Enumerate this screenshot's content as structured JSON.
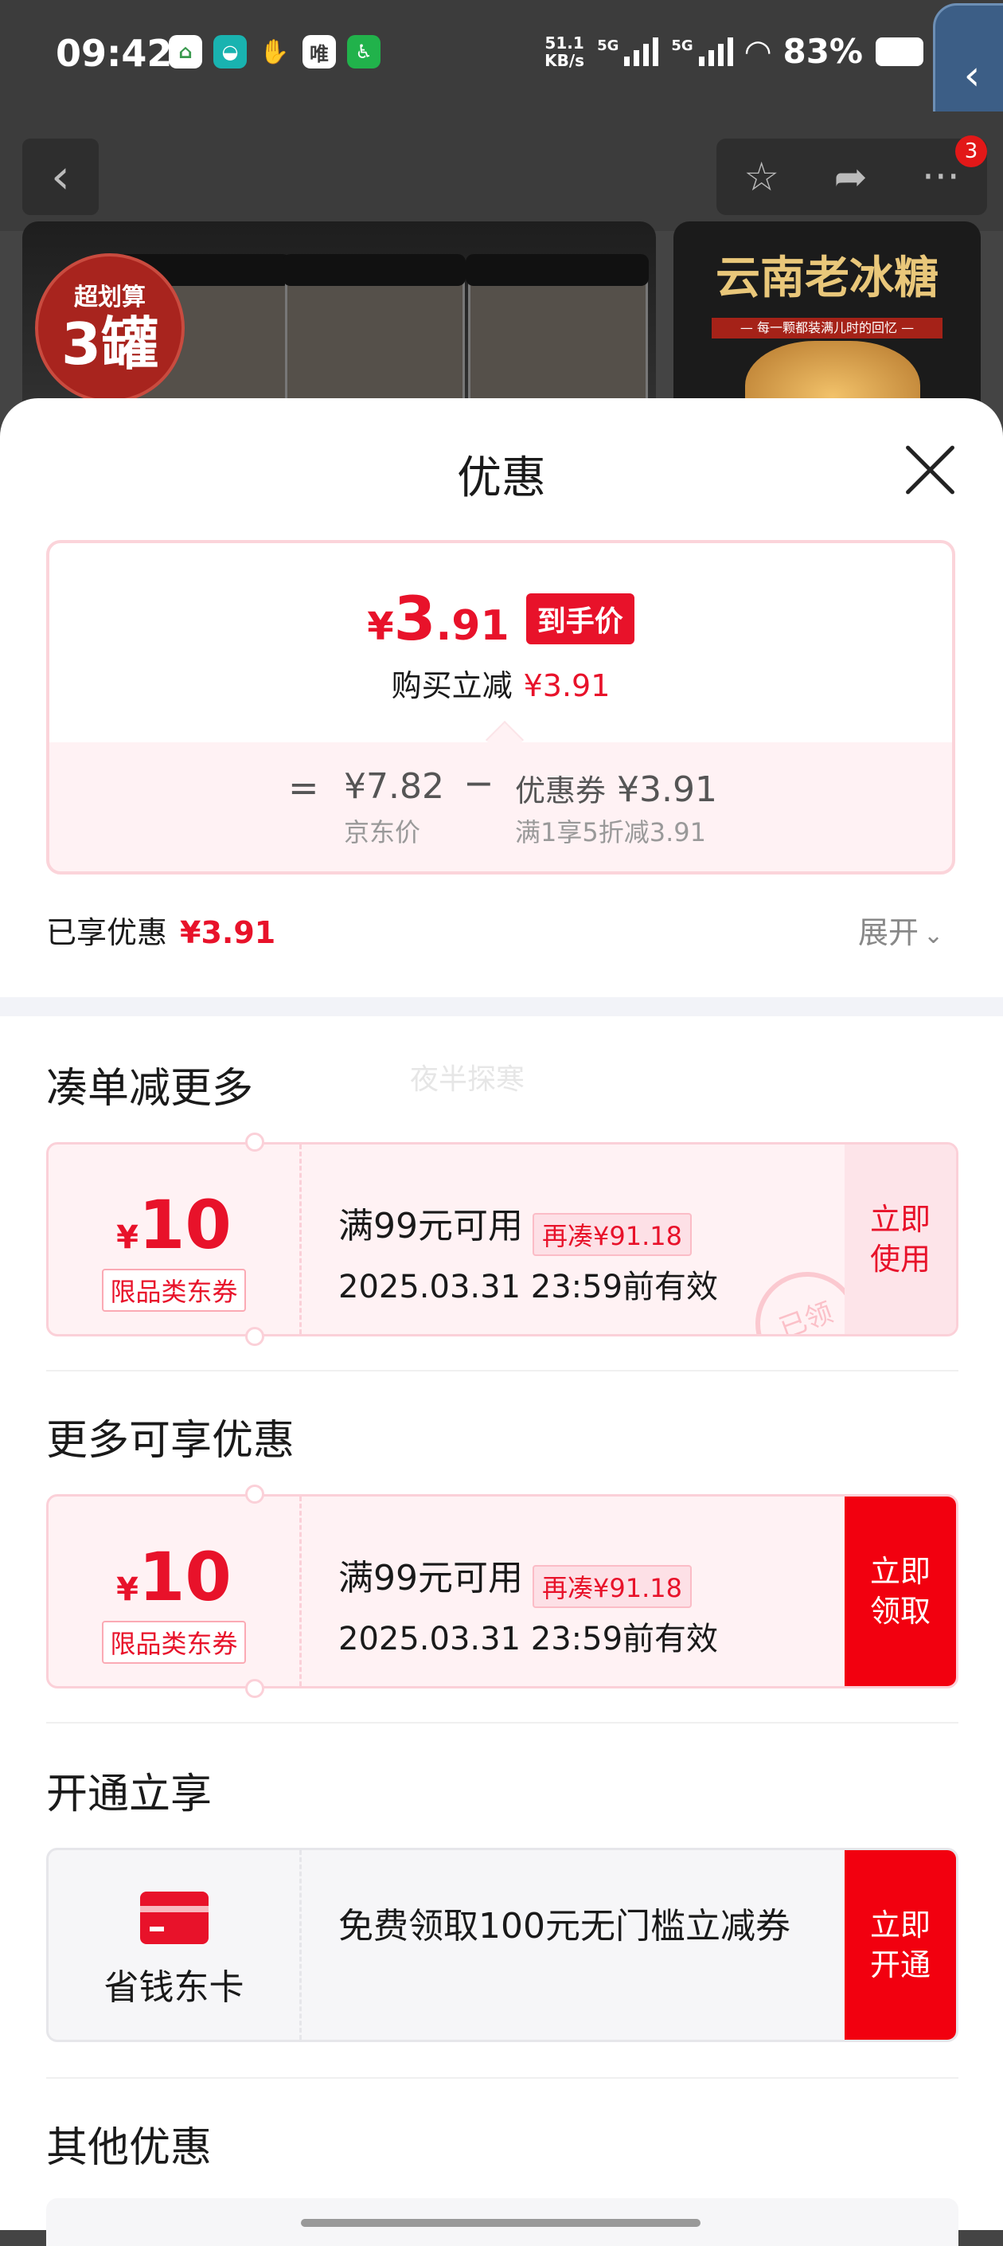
{
  "status_bar": {
    "time": "09:42",
    "net_speed_value": "51.1",
    "net_speed_unit": "KB/s",
    "signal1_label": "5G",
    "signal2_label": "5G",
    "battery": "83%",
    "app_icon_4_text": "唯",
    "icons": [
      "home-app-icon",
      "chat-app-icon",
      "handshake-app-icon",
      "vip-app-icon",
      "accessibility-icon",
      "wifi-icon",
      "battery-icon"
    ]
  },
  "product_page": {
    "notification_count": "3",
    "promo_badge_top": "超划算",
    "promo_badge_big": "3罐",
    "banner_title": "云南老冰糖",
    "banner_subtitle": "— 每一颗都装满儿时的回忆 —"
  },
  "sheet": {
    "title": "优惠",
    "price": {
      "symbol": "¥",
      "integer": "3",
      "decimal": ".91",
      "tag": "到手价",
      "reduce_label": "购买立减",
      "reduce_value": "¥3.91"
    },
    "calc": {
      "equals": "=",
      "jd_price": "¥7.82",
      "jd_price_label": "京东价",
      "minus": "−",
      "coupon_label": "优惠券",
      "coupon_value": "¥3.91",
      "coupon_desc": "满1享5折减3.91"
    },
    "enjoyed_label": "已享优惠",
    "enjoyed_value": "¥3.91",
    "expand_label": "展开",
    "watermark": "夜半探寒",
    "section_more": {
      "title": "凑单减更多",
      "coupon": {
        "symbol": "¥",
        "amount": "10",
        "type": "限品类东券",
        "condition": "满99元可用",
        "need": "再凑¥91.18",
        "expiry": "2025.03.31 23:59前有效",
        "button": "立即\n使用",
        "stamp": "已领"
      }
    },
    "section_extra": {
      "title": "更多可享优惠",
      "coupon": {
        "symbol": "¥",
        "amount": "10",
        "type": "限品类东券",
        "condition": "满99元可用",
        "need": "再凑¥91.18",
        "expiry": "2025.03.31 23:59前有效",
        "button": "立即\n领取"
      }
    },
    "section_open": {
      "title": "开通立享",
      "card_name": "省钱东卡",
      "card_desc": "免费领取100元无门槛立减券",
      "button": "立即\n开通"
    },
    "section_other": {
      "title": "其他优惠"
    }
  },
  "colors": {
    "accent_red": "#e8122a",
    "button_red": "#f2000f",
    "coupon_bg": "#fff2f4"
  }
}
